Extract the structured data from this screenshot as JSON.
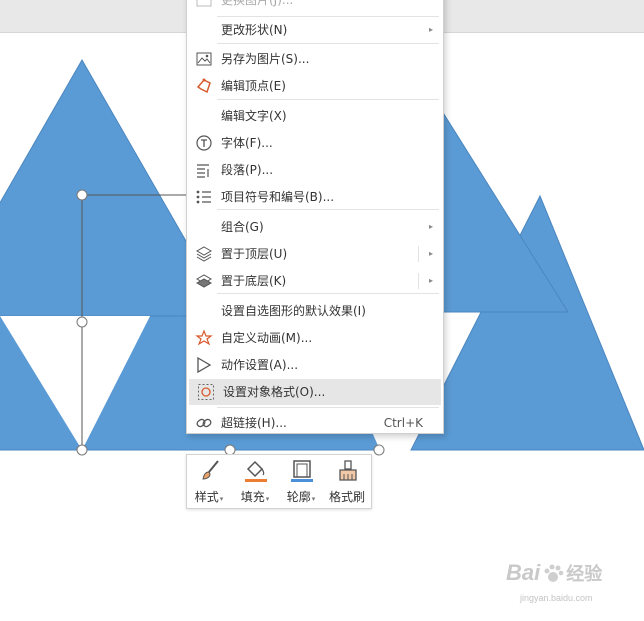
{
  "context_menu": {
    "items": [
      {
        "label": "更换图片(J)...",
        "icon": "picture-icon"
      },
      {
        "label": "更改形状(N)",
        "submenu": true
      },
      {
        "label": "另存为图片(S)...",
        "icon": "save-as-picture-icon"
      },
      {
        "label": "编辑顶点(E)",
        "icon": "edit-points-icon"
      },
      {
        "label": "编辑文字(X)"
      },
      {
        "label": "字体(F)...",
        "icon": "font-icon"
      },
      {
        "label": "段落(P)...",
        "icon": "paragraph-icon"
      },
      {
        "label": "项目符号和编号(B)...",
        "icon": "bullets-icon"
      },
      {
        "label": "组合(G)",
        "submenu": true
      },
      {
        "label": "置于顶层(U)",
        "icon": "bring-to-front-icon",
        "submenu": true
      },
      {
        "label": "置于底层(K)",
        "icon": "send-to-back-icon",
        "submenu": true
      },
      {
        "label": "设置自选图形的默认效果(I)"
      },
      {
        "label": "自定义动画(M)...",
        "icon": "custom-animation-icon"
      },
      {
        "label": "动作设置(A)...",
        "icon": "action-settings-icon"
      },
      {
        "label": "设置对象格式(O)...",
        "icon": "format-object-icon",
        "highlighted": true
      },
      {
        "label": "超链接(H)...",
        "icon": "hyperlink-icon",
        "shortcut": "Ctrl+K"
      }
    ],
    "submenu_arrow": "▸"
  },
  "toolbar": {
    "style_label": "样式",
    "fill_label": "填充",
    "outline_label": "轮廓",
    "format_painter_label": "格式刷",
    "dropdown_arrow": "▾"
  },
  "watermark": {
    "brand": "Bai",
    "brand_cn": "经验",
    "url": "jingyan.baidu.com"
  },
  "colors": {
    "shape_fill": "#5b9bd5",
    "shape_stroke": "#4a86bf",
    "menu_highlight": "#e6e6e6",
    "fill_accent": "#ed7d31",
    "outline_accent": "#4a90d9"
  }
}
